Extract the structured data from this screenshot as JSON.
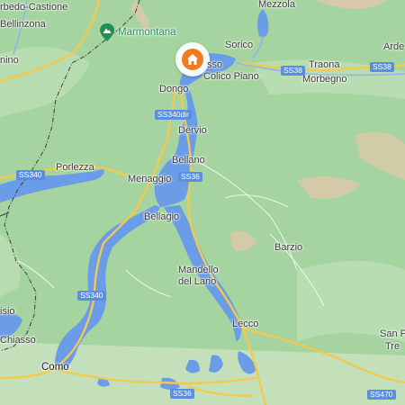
{
  "map": {
    "towns": {
      "arbedo": "rbedo-Castione",
      "bellinzona": "Bellinzona",
      "mezzola": "Mezzola",
      "sorico": "Sorico",
      "ardenno": "Arde",
      "gera": "sso",
      "colico": "Colico Piano",
      "traona": "Traona",
      "morbegno": "Morbegno",
      "giubiasco": "nino",
      "dongo": "Dongo",
      "dervio": "Dervio",
      "porlezza": "Porlezza",
      "menaggio": "Menaggio",
      "bellano": "Bellano",
      "bellagio": "Bellagio",
      "barzio": "Barzio",
      "mandello": "Mandello\ndel Lario",
      "lugano": "isio",
      "chiasso": "Chiasso",
      "lecco": "Lecco",
      "como": "Como",
      "san_pietro": "San P",
      "san_pietro2": "Tre"
    },
    "poi": {
      "name": "Marmontana",
      "icon": "mountain-pin-icon",
      "color": "#1f8f55"
    },
    "roads": {
      "ss38_a": "SS38",
      "ss38_b": "SS38",
      "ss340dir": "SS340dir",
      "ss340_a": "SS340",
      "ss36_a": "SS36",
      "ss340_b": "SS340",
      "ss36_b": "SS36",
      "ss470": "SS470"
    },
    "pin": {
      "icon": "home-icon",
      "color": "#f07a1f"
    },
    "colors": {
      "land": "#a6d4a0",
      "water": "#6a9ce8",
      "road": "#f2c94c",
      "relief": "#d9c9a8",
      "border": "#3a3a3a"
    }
  }
}
